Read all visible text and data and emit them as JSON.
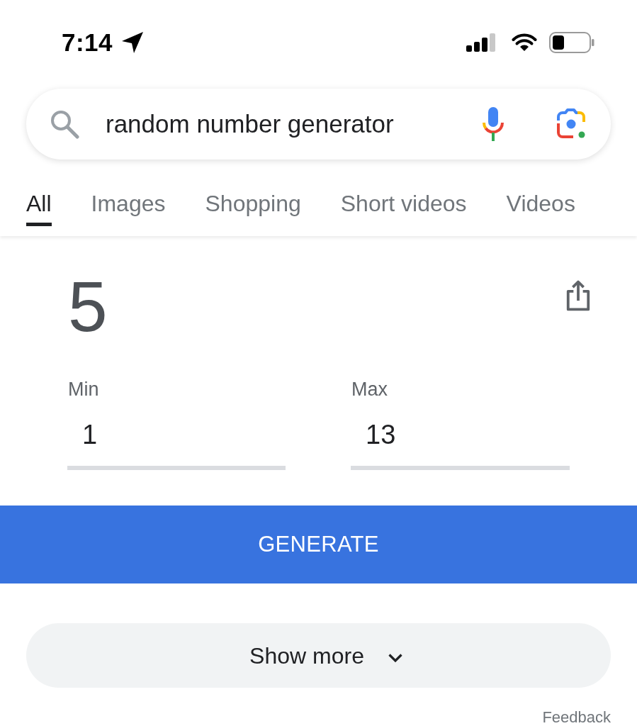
{
  "status_bar": {
    "time": "7:14"
  },
  "search": {
    "value": "random number generator"
  },
  "tabs": [
    {
      "label": "All",
      "selected": true
    },
    {
      "label": "Images",
      "selected": false
    },
    {
      "label": "Shopping",
      "selected": false
    },
    {
      "label": "Short videos",
      "selected": false
    },
    {
      "label": "Videos",
      "selected": false
    }
  ],
  "result": {
    "number": "5"
  },
  "range_fields": [
    {
      "label": "Min",
      "value": "1"
    },
    {
      "label": "Max",
      "value": "13"
    }
  ],
  "generate_button": {
    "label": "GENERATE"
  },
  "show_more_button": {
    "label": "Show more"
  },
  "feedback_link": {
    "label": "Feedback"
  }
}
